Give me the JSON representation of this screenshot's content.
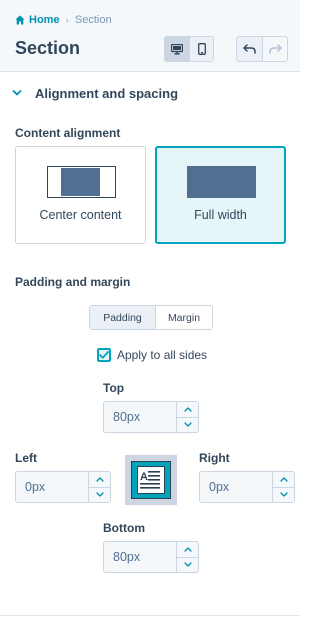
{
  "breadcrumb": {
    "home": "Home",
    "separator": "›",
    "current": "Section"
  },
  "page_title": "Section",
  "device_toggle": {
    "desktop_icon": "desktop-icon",
    "mobile_icon": "mobile-icon",
    "selected": "desktop"
  },
  "history": {
    "undo_icon": "undo-icon",
    "redo_icon": "redo-icon"
  },
  "section": {
    "label": "Alignment and spacing",
    "expanded": true
  },
  "content_alignment": {
    "heading": "Content alignment",
    "options": [
      {
        "label": "Center content",
        "selected": false
      },
      {
        "label": "Full width",
        "selected": true
      }
    ]
  },
  "padding_margin": {
    "heading": "Padding and margin",
    "tabs": [
      {
        "label": "Padding",
        "active": true
      },
      {
        "label": "Margin",
        "active": false
      }
    ],
    "apply_all": {
      "label": "Apply to all sides",
      "checked": true
    },
    "fields": {
      "top": {
        "label": "Top",
        "placeholder": "80px"
      },
      "left": {
        "label": "Left",
        "placeholder": "0px"
      },
      "right": {
        "label": "Right",
        "placeholder": "0px"
      },
      "bottom": {
        "label": "Bottom",
        "placeholder": "80px"
      }
    }
  },
  "colors": {
    "accent": "#00a4bd",
    "link": "#0091ae",
    "text": "#33475b",
    "border": "#cbd6e2",
    "selected_bg": "#e5f5f8",
    "block_fill": "#516f90"
  }
}
